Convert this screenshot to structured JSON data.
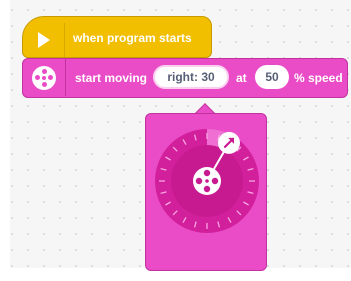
{
  "hat_block": {
    "icon": "play-icon",
    "label": "when program starts",
    "color": "#f2be00"
  },
  "motor_block": {
    "icon": "motor-icon",
    "text_start": "start moving",
    "direction_value": "right: 30",
    "text_at": "at",
    "speed_value": "50",
    "text_speed": "% speed",
    "color": "#ea4cc8"
  },
  "direction_picker": {
    "icon": "motor-icon",
    "handle_icon": "arrow-up-right-icon",
    "angle_degrees": 30
  }
}
